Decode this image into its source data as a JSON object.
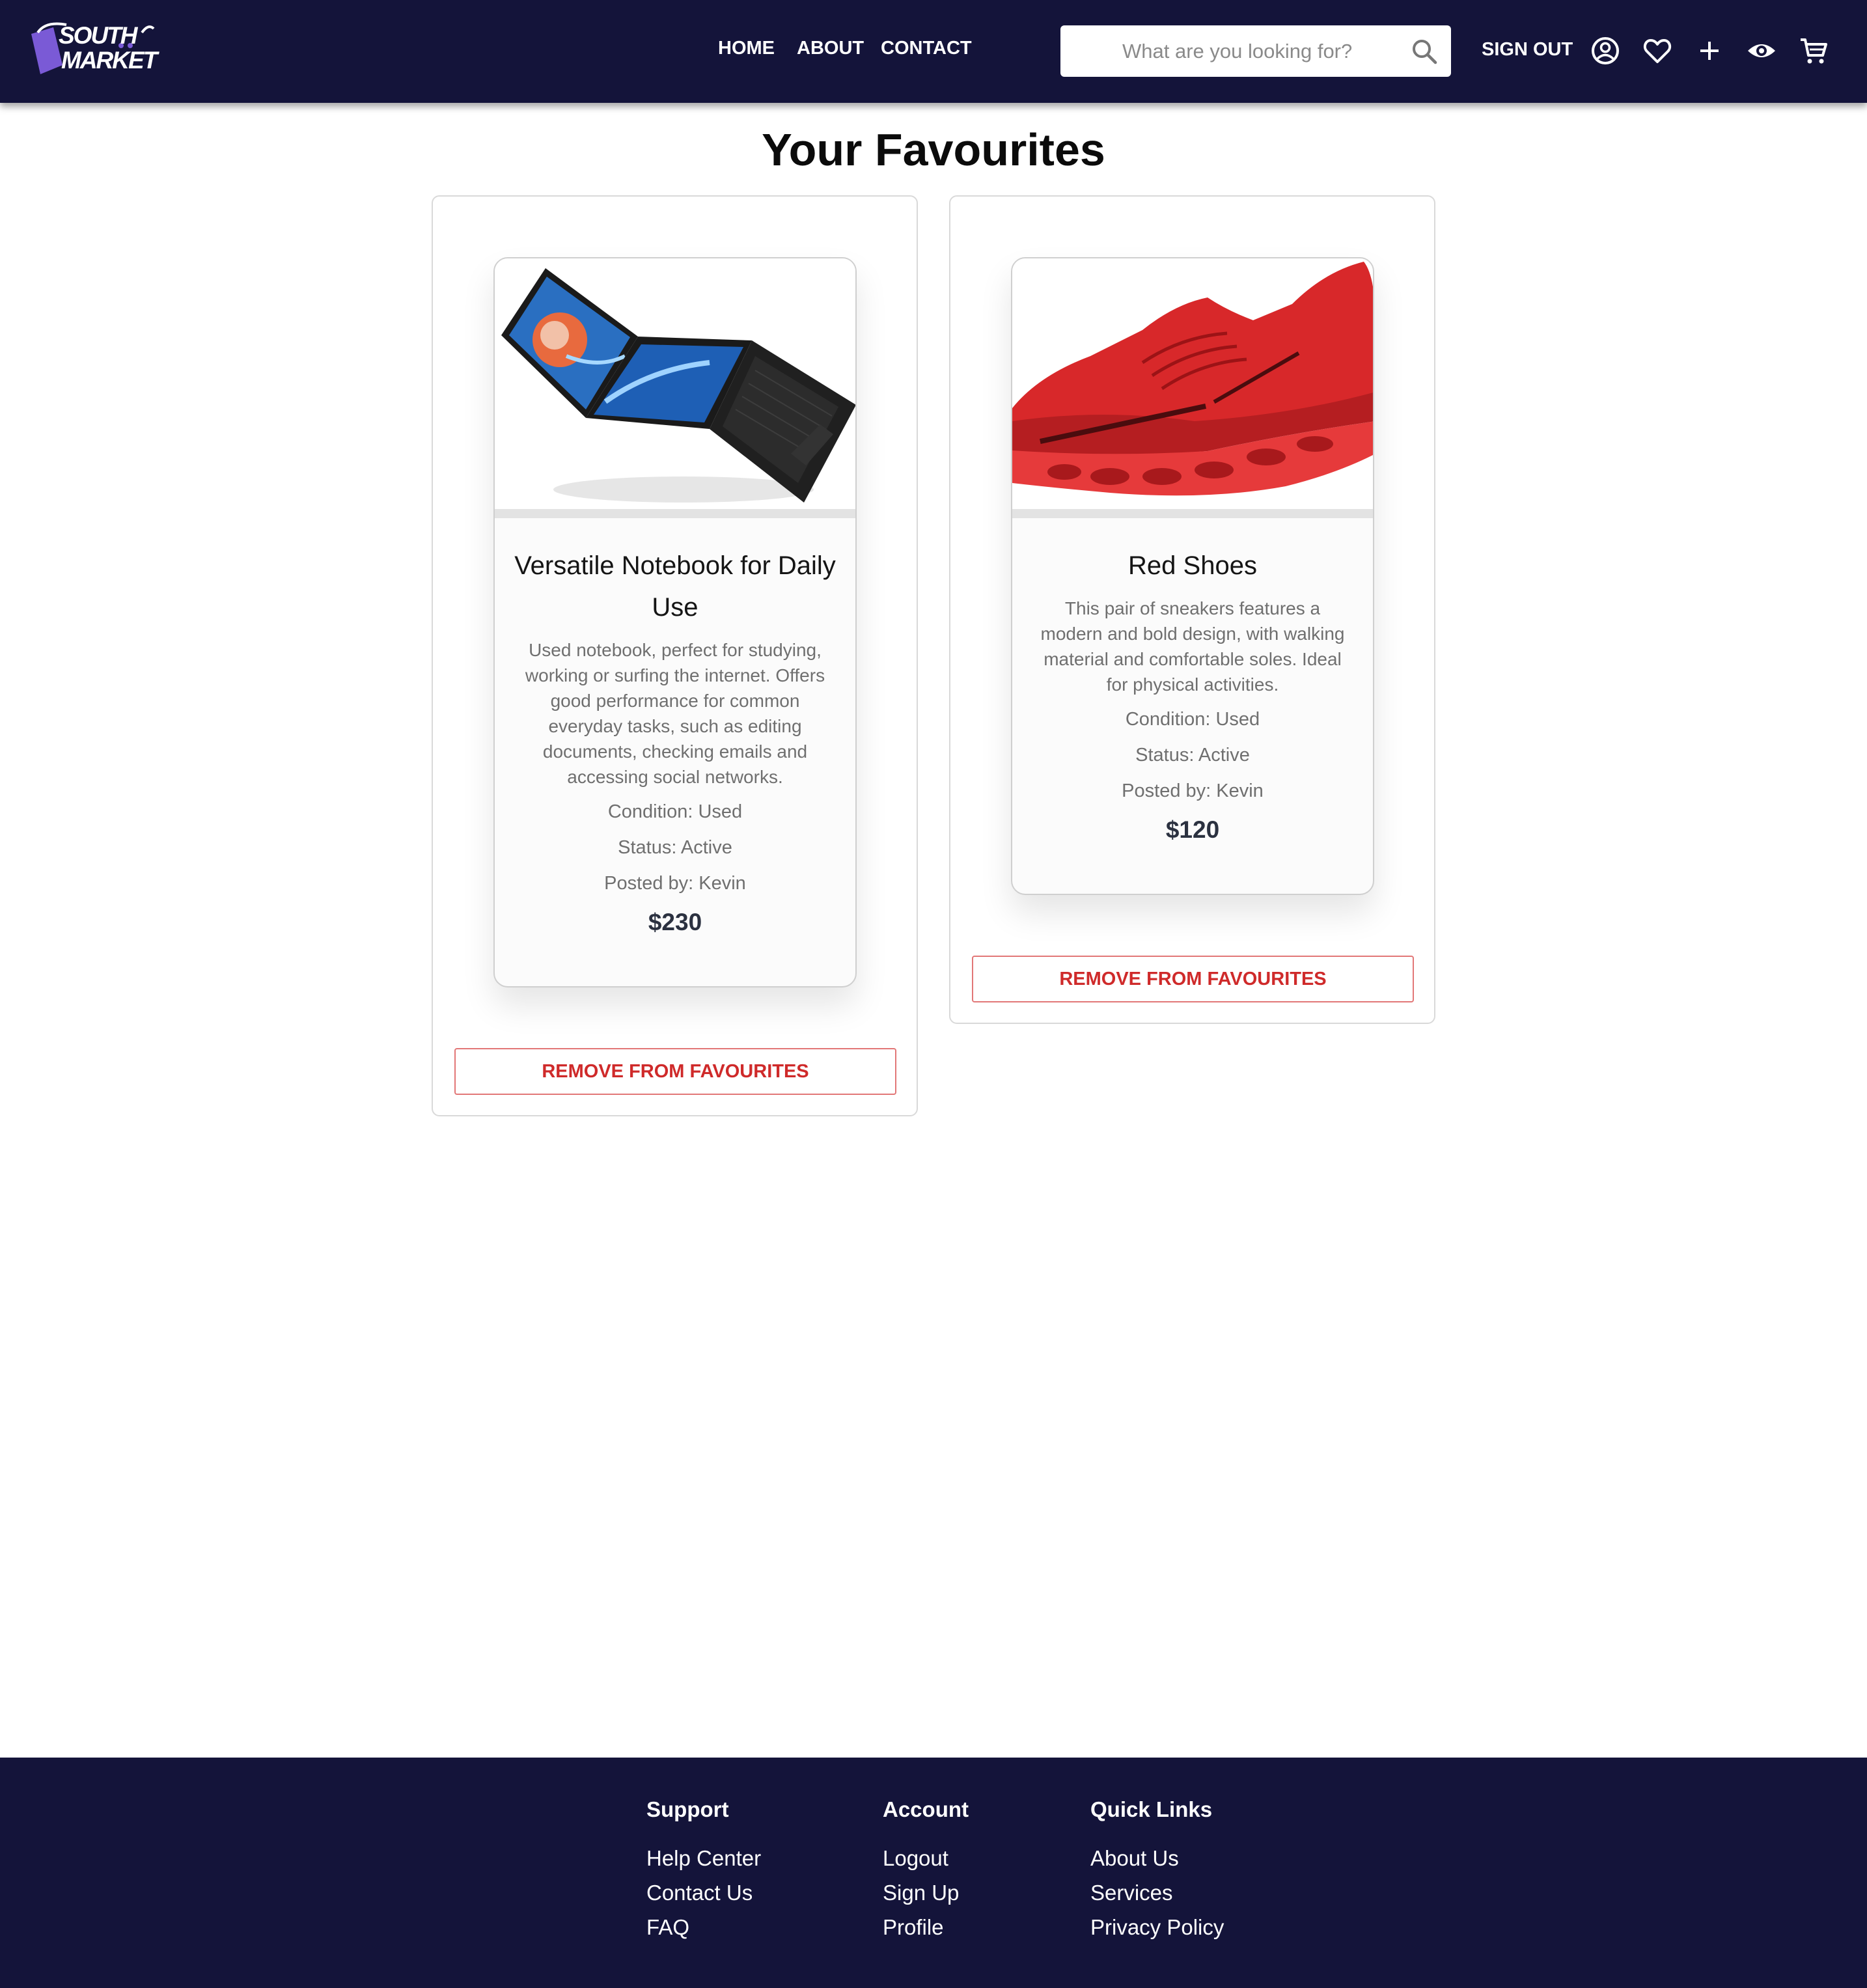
{
  "header": {
    "logo": {
      "line1": "SOUTH",
      "line2": "MARKET"
    },
    "nav": [
      {
        "label": "HOME"
      },
      {
        "label": "ABOUT"
      },
      {
        "label": "CONTACT"
      }
    ],
    "search": {
      "placeholder": "What are you looking for?",
      "value": ""
    },
    "sign_out_label": "SIGN OUT",
    "icons": [
      "account-icon",
      "heart-icon",
      "plus-icon",
      "eye-icon",
      "cart-icon"
    ],
    "bg_color": "#14143a"
  },
  "main": {
    "title": "Your Favourites",
    "favourites": [
      {
        "image": "laptop-image",
        "title": "Versatile Notebook for Daily Use",
        "description": "Used notebook, perfect for studying, working or surfing the internet. Offers good performance for common everyday tasks, such as editing documents, checking emails and accessing social networks.",
        "condition": "Condition: Used",
        "status": "Status: Active",
        "posted_by": "Posted by: Kevin",
        "price": "$230",
        "remove_label": "REMOVE FROM FAVOURITES"
      },
      {
        "image": "red-shoes-image",
        "title": "Red Shoes",
        "description": "This pair of sneakers features a modern and bold design, with walking material and comfortable soles. Ideal for physical activities.",
        "condition": "Condition: Used",
        "status": "Status: Active",
        "posted_by": "Posted by: Kevin",
        "price": "$120",
        "remove_label": "REMOVE FROM FAVOURITES"
      }
    ],
    "remove_color": "#cf2a2a"
  },
  "footer": {
    "columns": [
      {
        "heading": "Support",
        "links": [
          "Help Center",
          "Contact Us",
          "FAQ"
        ]
      },
      {
        "heading": "Account",
        "links": [
          "Logout",
          "Sign Up",
          "Profile"
        ]
      },
      {
        "heading": "Quick Links",
        "links": [
          "About Us",
          "Services",
          "Privacy Policy"
        ]
      }
    ]
  }
}
